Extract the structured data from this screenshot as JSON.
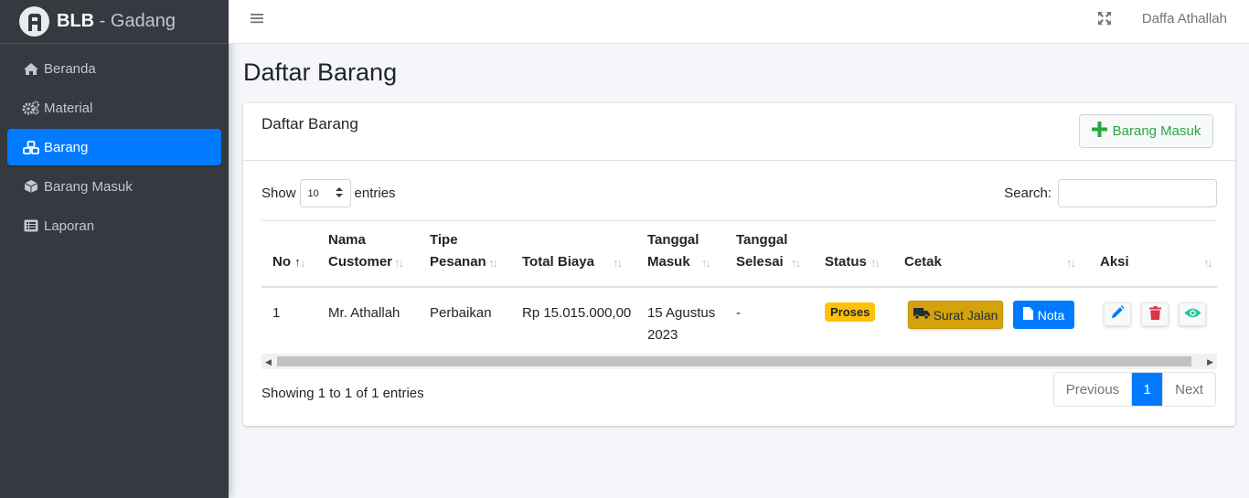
{
  "brand": {
    "bold": "BLB",
    "light": " - Gadang"
  },
  "sidebar": {
    "items": [
      {
        "label": "Beranda",
        "icon": "home-icon"
      },
      {
        "label": "Material",
        "icon": "cogs-icon"
      },
      {
        "label": "Barang",
        "icon": "cubes-icon",
        "active": true
      },
      {
        "label": "Barang Masuk",
        "icon": "box-icon"
      },
      {
        "label": "Laporan",
        "icon": "list-icon"
      }
    ]
  },
  "topbar": {
    "username": "Daffa Athallah"
  },
  "page": {
    "title": "Daftar Barang"
  },
  "card": {
    "title": "Daftar Barang",
    "add_button": "Barang Masuk"
  },
  "table_controls": {
    "show_label": "Show",
    "entries_value": "10",
    "entries_label": "entries",
    "search_label": "Search:",
    "search_value": ""
  },
  "table": {
    "headers": {
      "no": "No",
      "nama_customer_1": "Nama",
      "nama_customer_2": "Customer",
      "tipe_pesanan_1": "Tipe",
      "tipe_pesanan_2": "Pesanan",
      "total_biaya": "Total Biaya",
      "tanggal_masuk_1": "Tanggal",
      "tanggal_masuk_2": "Masuk",
      "tanggal_selesai_1": "Tanggal",
      "tanggal_selesai_2": "Selesai",
      "status": "Status",
      "cetak": "Cetak",
      "aksi": "Aksi"
    },
    "rows": [
      {
        "no": "1",
        "nama_customer": "Mr. Athallah",
        "tipe_pesanan": "Perbaikan",
        "total_biaya": "Rp 15.015.000,00",
        "tanggal_masuk_1": "15 Agustus",
        "tanggal_masuk_2": "2023",
        "tanggal_selesai": "-",
        "status": "Proses",
        "cetak_surat": "Surat Jalan",
        "cetak_nota": "Nota"
      }
    ]
  },
  "footer": {
    "info": "Showing 1 to 1 of 1 entries",
    "previous": "Previous",
    "current_page": "1",
    "next": "Next"
  },
  "colors": {
    "sidebar_bg": "#343a40",
    "primary": "#007bff",
    "success": "#28a745",
    "warning": "#ffc107",
    "danger": "#dc3545",
    "info": "#20c997"
  }
}
